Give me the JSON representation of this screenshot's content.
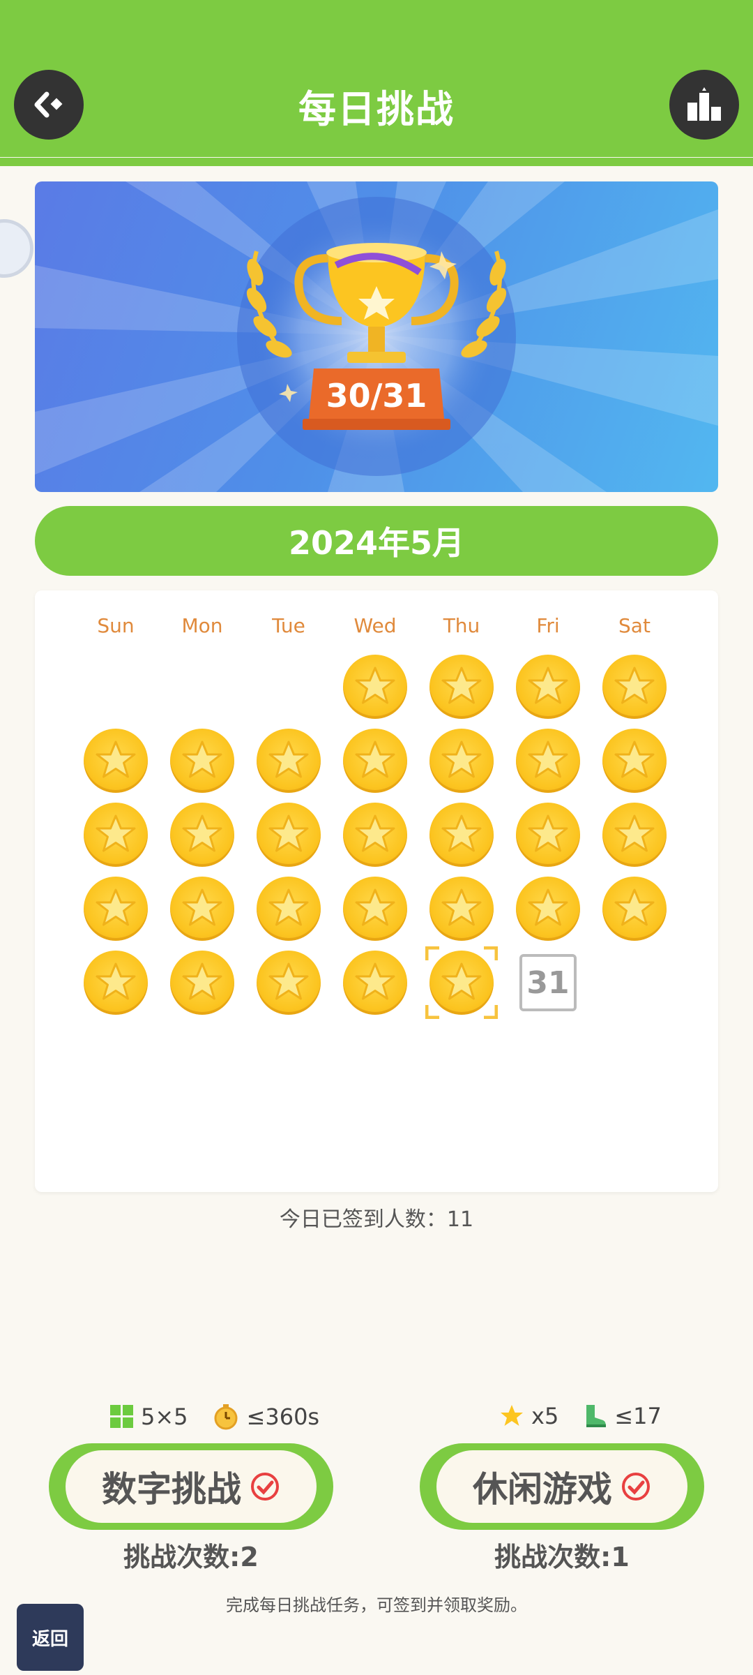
{
  "header": {
    "title": "每日挑战",
    "back_icon": "back-arrow-icon",
    "leaderboard_icon": "podium-icon",
    "color": "#7dcb42"
  },
  "banner": {
    "trophy_score": "30/31"
  },
  "calendar": {
    "month_label": "2024年5月",
    "weekdays": [
      "Sun",
      "Mon",
      "Tue",
      "Wed",
      "Thu",
      "Fri",
      "Sat"
    ],
    "completed_days": 30,
    "today": 30,
    "pending_day_label": "31"
  },
  "checkin": {
    "text": "今日已签到人数：11"
  },
  "challenges": [
    {
      "label": "数字挑战",
      "req1_text": "5×5",
      "req1_icon": "grid-icon",
      "req2_text": "≤360s",
      "req2_icon": "timer-icon",
      "attempts": "挑战次数:2",
      "completed": true
    },
    {
      "label": "休闲游戏",
      "req1_text": "x5",
      "req1_icon": "star-icon",
      "req2_text": "≤17",
      "req2_icon": "boot-icon",
      "attempts": "挑战次数:1",
      "completed": true
    }
  ],
  "footer": {
    "hint": "完成每日挑战任务，可签到并领取奖励。",
    "back_tile_label": "返回"
  },
  "colors": {
    "accent_green": "#7dcb42",
    "coin_gold": "#fcc521",
    "weekday_orange": "#e08a3c",
    "check_red": "#e84040"
  }
}
